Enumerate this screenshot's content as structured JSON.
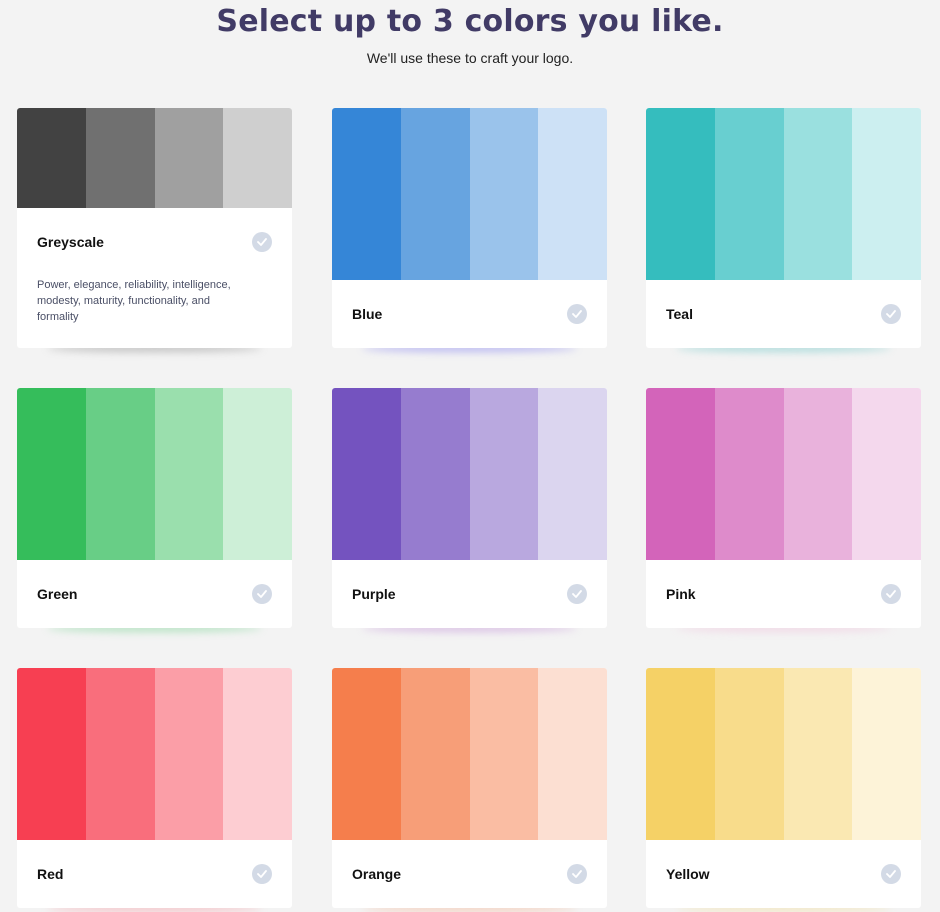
{
  "header": {
    "title": "Select up to 3 colors you like.",
    "subtitle": "We'll use these to craft your logo."
  },
  "palettes": [
    {
      "name": "Greyscale",
      "description": "Power, elegance, reliability, intelligence, modesty, maturity, functionality, and formality",
      "expanded": true,
      "selected": false,
      "colors": [
        "#424242",
        "#707070",
        "#a0a0a0",
        "#cfcfcf"
      ],
      "shadow": "#9a9a9a"
    },
    {
      "name": "Blue",
      "selected": false,
      "colors": [
        "#3586d7",
        "#67a4e0",
        "#9ac3eb",
        "#cde1f6"
      ],
      "shadow": "#8f8cf0"
    },
    {
      "name": "Teal",
      "selected": false,
      "colors": [
        "#35bdbe",
        "#68cfd0",
        "#9ae0df",
        "#cceff0"
      ],
      "shadow": "#7ac9c9"
    },
    {
      "name": "Green",
      "selected": false,
      "colors": [
        "#35bd5b",
        "#68ce86",
        "#9adfad",
        "#cdefd7"
      ],
      "shadow": "#86d69c"
    },
    {
      "name": "Purple",
      "selected": false,
      "colors": [
        "#7453bf",
        "#967ccf",
        "#b9a8df",
        "#dbd5ef"
      ],
      "shadow": "#c79ad9"
    },
    {
      "name": "Pink",
      "selected": false,
      "colors": [
        "#d364ba",
        "#de8bcb",
        "#e9b2dc",
        "#f4d8ed"
      ],
      "shadow": "#efc4dc"
    },
    {
      "name": "Red",
      "selected": false,
      "colors": [
        "#f73f52",
        "#f96e7c",
        "#fb9ea7",
        "#fdcdd2"
      ],
      "shadow": "#f7a0a8"
    },
    {
      "name": "Orange",
      "selected": false,
      "colors": [
        "#f57e4c",
        "#f79e78",
        "#fabda3",
        "#fcdfd2"
      ],
      "shadow": "#f5b89a"
    },
    {
      "name": "Yellow",
      "selected": false,
      "colors": [
        "#f5d166",
        "#f8dc8b",
        "#fae8b2",
        "#fdf3d8"
      ],
      "shadow": "#f3de9e"
    }
  ],
  "icons": {
    "check": "check-circle-icon"
  }
}
